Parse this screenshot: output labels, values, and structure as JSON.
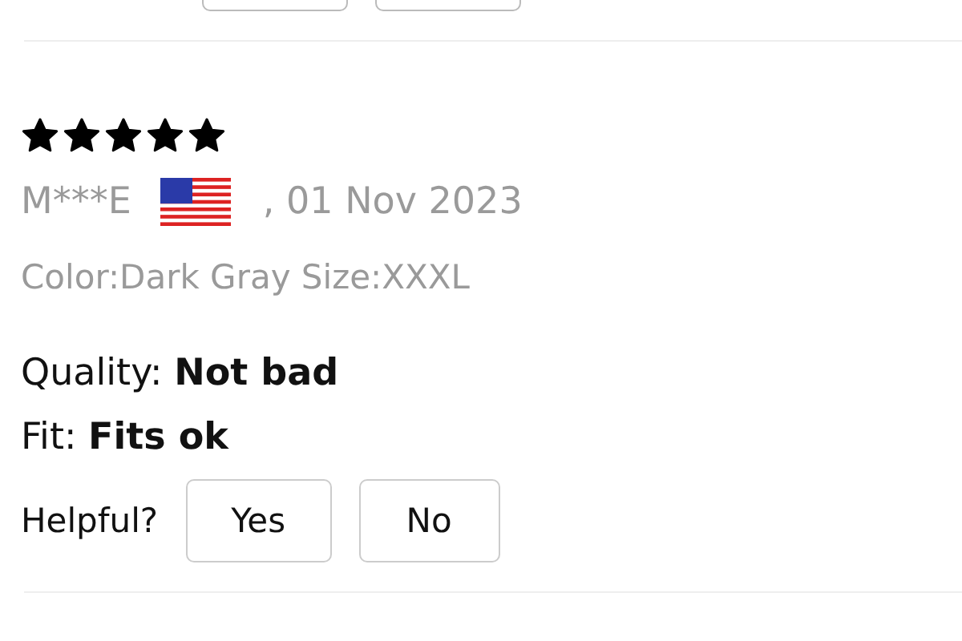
{
  "review": {
    "stars": 5,
    "author": "M***E",
    "date": ", 01 Nov 2023",
    "variant": "Color:Dark Gray Size:XXXL",
    "attributes": [
      {
        "label": "Quality:",
        "value": "Not bad"
      },
      {
        "label": "Fit:",
        "value": "Fits ok"
      }
    ],
    "helpful": {
      "label": "Helpful?",
      "buttons": [
        "Yes",
        "No"
      ]
    }
  }
}
